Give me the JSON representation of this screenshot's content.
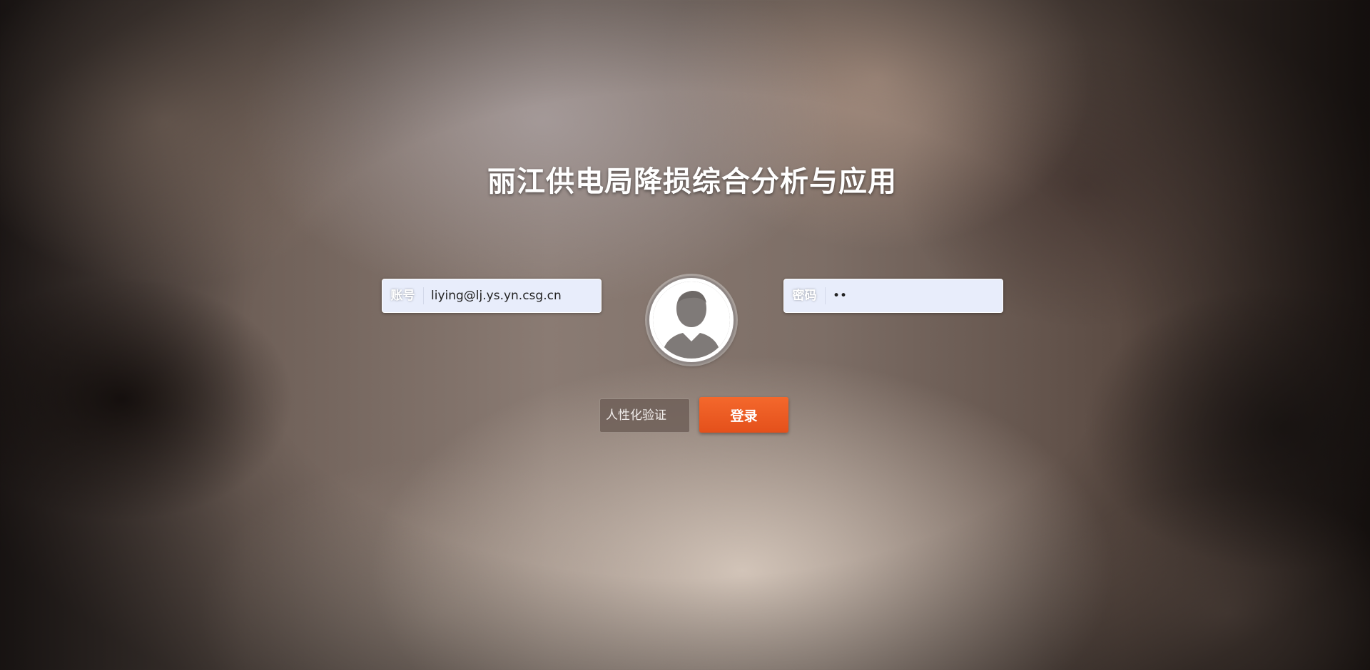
{
  "page": {
    "title": "丽江供电局降损综合分析与应用"
  },
  "login_form": {
    "account_label": "账号",
    "account_value": "liying@lj.ys.yn.csg.cn",
    "password_label": "密码",
    "password_value": "••",
    "verify_label": "人性化验证",
    "login_button": "登录"
  },
  "icons": {
    "avatar": "user-avatar-icon"
  },
  "colors": {
    "login_button": "#f05a24",
    "field_background": "#e8edfb",
    "title_text": "#ffffff"
  }
}
